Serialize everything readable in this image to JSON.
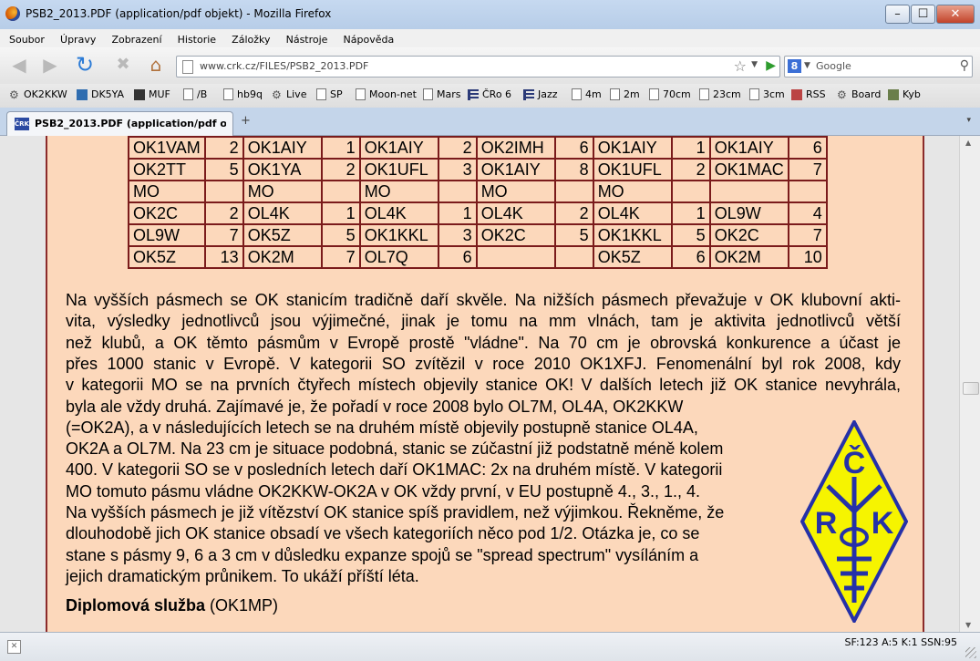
{
  "window": {
    "title": "PSB2_2013.PDF (application/pdf objekt) - Mozilla Firefox",
    "buttons": [
      "–",
      "☐",
      "✕"
    ]
  },
  "menu": [
    "Soubor",
    "Úpravy",
    "Zobrazení",
    "Historie",
    "Záložky",
    "Nástroje",
    "Nápověda"
  ],
  "nav": {
    "url": "www.crk.cz/FILES/PSB2_2013.PDF",
    "search_placeholder": "Google",
    "search_engine_letter": "8"
  },
  "bookmarks": [
    {
      "label": "OK2KKW",
      "icon": "gear-icon"
    },
    {
      "label": "DK5YA",
      "icon": "grid-icon"
    },
    {
      "label": "MUF",
      "icon": "image-icon"
    },
    {
      "label": "/B",
      "icon": "page-icon"
    },
    {
      "label": "hb9q",
      "icon": "page-icon"
    },
    {
      "label": "Live",
      "icon": "gear-icon"
    },
    {
      "label": "SP",
      "icon": "page-icon"
    },
    {
      "label": "Moon-net",
      "icon": "page-icon"
    },
    {
      "label": "Mars",
      "icon": "page-icon"
    },
    {
      "label": "ČRo 6",
      "icon": "bars-icon"
    },
    {
      "label": "Jazz",
      "icon": "bars-icon"
    },
    {
      "label": "4m",
      "icon": "page-icon"
    },
    {
      "label": "2m",
      "icon": "page-icon"
    },
    {
      "label": "70cm",
      "icon": "page-icon"
    },
    {
      "label": "23cm",
      "icon": "page-icon"
    },
    {
      "label": "3cm",
      "icon": "page-icon"
    },
    {
      "label": "RSS",
      "icon": "rss-icon"
    },
    {
      "label": "Board",
      "icon": "gear-icon"
    },
    {
      "label": "Kyb",
      "icon": "photo-icon"
    }
  ],
  "tab": {
    "label": "PSB2_2013.PDF (application/pdf obj...",
    "icon_text": "ČRK",
    "new_tab": "+",
    "list": "▾"
  },
  "table": {
    "rows": [
      [
        "OK1VAM",
        "2",
        "OK1AIY",
        "1",
        "OK1AIY",
        "2",
        "OK2IMH",
        "6",
        "OK1AIY",
        "1",
        "OK1AIY",
        "6"
      ],
      [
        "OK2TT",
        "5",
        "OK1YA",
        "2",
        "OK1UFL",
        "3",
        "OK1AIY",
        "8",
        "OK1UFL",
        "2",
        "OK1MAC",
        "7"
      ],
      [
        "MO",
        "",
        "MO",
        "",
        "MO",
        "",
        "MO",
        "",
        "MO",
        "",
        "",
        ""
      ],
      [
        "OK2C",
        "2",
        "OL4K",
        "1",
        "OL4K",
        "1",
        "OL4K",
        "2",
        "OL4K",
        "1",
        "OL9W",
        "4"
      ],
      [
        "OL9W",
        "7",
        "OK5Z",
        "5",
        "OK1KKL",
        "3",
        "OK2C",
        "5",
        "OK1KKL",
        "5",
        "OK2C",
        "7"
      ],
      [
        "OK5Z",
        "13",
        "OK2M",
        "7",
        "OL7Q",
        "6",
        "",
        "",
        "OK5Z",
        "6",
        "OK2M",
        "10"
      ]
    ]
  },
  "text": {
    "full_lines": [
      "Na vyšších pásmech se OK stanicím tradičně daří skvěle. Na nižších pásmech převažuje v OK klubovní akti-",
      "vita, výsledky jednotlivců jsou výjimečné, jinak je tomu na mm vlnách, tam je aktivita jednotlivců větší",
      "než klubů, a OK těmto pásmům v Evropě prostě \"vládne\". Na 70 cm je obrovská konkurence a účast je",
      "přes 1000 stanic v Evropě. V kategorii SO zvítězil v roce 2010 OK1XFJ. Fenomenální byl rok 2008, kdy",
      "v kategorii MO se na prvních čtyřech místech objevily stanice OK! V dalších letech již OK stanice nevyhrála,"
    ],
    "narrow_lines": [
      "byla ale vždy druhá. Zajímavé je, že pořadí v roce 2008 bylo OL7M, OL4A, OK2KKW",
      "(=OK2A), a v následujících letech se na druhém místě objevily postupně stanice OL4A,",
      "OK2A a OL7M. Na 23 cm je situace podobná, stanic se zúčastní již podstatně méně kolem",
      "400. V kategorii SO se v posledních letech daří OK1MAC: 2x na druhém místě. V kategorii",
      "MO tomuto pásmu vládne OK2KKW-OK2A v OK vždy první, v EU postupně 4., 3., 1., 4.",
      "Na vyšších pásmech je již vítězství OK stanice spíš pravidlem, než výjimkou. Řekněme, že",
      "dlouhodobě jich OK stanice obsadí ve všech kategoriích něco pod 1/2. Otázka je, co se",
      "stane s pásmy 9, 6 a 3 cm v důsledku expanze spojů se \"spread spectrum\" vysíláním a",
      "jejich dramatickým průnikem. To ukáží příští léta."
    ],
    "heading_bold": "Diplomová služba",
    "heading_rest": " (OK1MP)"
  },
  "logo": {
    "letters": [
      "Č",
      "R",
      "K"
    ],
    "colors": {
      "fill": "#f6f400",
      "stroke": "#2531a8"
    }
  },
  "status": {
    "right": "SF:123 A:5 K:1 SSN:95"
  },
  "colors": {
    "page_bg": "#fcd8bb",
    "table_border": "#7a1b1b",
    "page_border": "#8b2a2a"
  }
}
